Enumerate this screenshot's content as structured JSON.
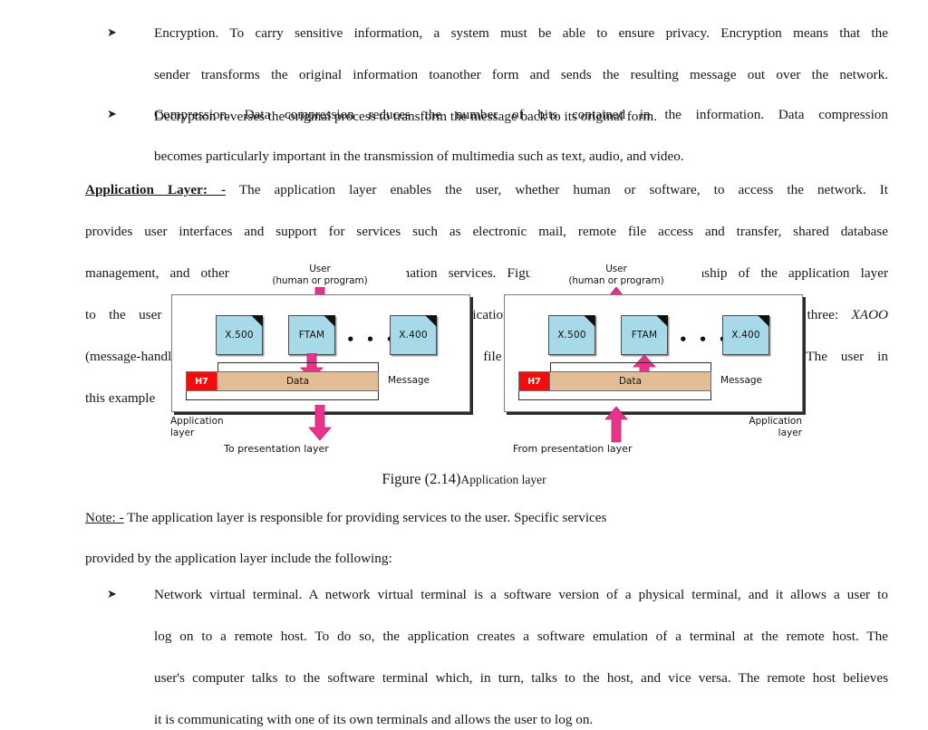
{
  "document": {
    "page_kind": "lecture-notes-page",
    "figure_number": "2.14"
  },
  "bullets_top": [
    {
      "marker": "➤",
      "lines": [
        "Encryption. To carry sensitive information, a system must be able to ensure privacy. Encryption means that the",
        "sender transforms the original information toanother form and sends the resulting message out over the network.",
        "Decryption reverses the original process to transform the message back to its original form."
      ]
    },
    {
      "marker": "➤",
      "lines": [
        "Compression. Data compression reduces the number of bits contained in the information. Data compression",
        "becomes particularly important in the transmission of multimedia such as text, audio, and video."
      ]
    }
  ],
  "application_layer_para": {
    "lead": "Application Layer: -",
    "line1_rest": "The application layer enables the user, whether human or software, to access the network. It",
    "line2": "provides user interfaces and support for services such as electronic mail, remote file access and transfer, shared database",
    "line3": "management, and other types of distributed information services. Figure 2.14 shows the relationship of the application layer",
    "line4_a": "to the user and the presentationlayer. Of the many application services available, the figure shows only three:",
    "line4_italic": "XAOO",
    "line5": "(message-handling services), X.500 (directory services), and file transfer, access, and management (FTAM). The user in",
    "line6": "this example"
  },
  "figure": {
    "caption_big": "Figure (2.14)",
    "caption_small": "Application layer",
    "left_panel": {
      "user_line1": "User",
      "user_line2": "(human or program)",
      "docs": [
        "X.500",
        "FTAM",
        "X.400"
      ],
      "dots": "• • •",
      "header_label": "H7",
      "data_label": "Data",
      "message_label": "Message",
      "layer_line1": "Application",
      "layer_line2": "layer",
      "flow_label": "To presentation layer",
      "flow_direction": "down"
    },
    "right_panel": {
      "user_line1": "User",
      "user_line2": "(human or program)",
      "docs": [
        "X.500",
        "FTAM",
        "X.400"
      ],
      "dots": "• • •",
      "header_label": "H7",
      "data_label": "Data",
      "message_label": "Message",
      "layer_line1": "Application",
      "layer_line2": "layer",
      "flow_label": "From presentation layer",
      "flow_direction": "up"
    },
    "colors": {
      "arrow": "#e8338a",
      "doc_fill": "#a8d9e8",
      "header_fill": "#f40d0d",
      "data_fill": "#e3bd95",
      "panel_border": "#7c7c7c",
      "panel_shadow": "#2b2b2b"
    }
  },
  "note": {
    "lead": "Note: -",
    "line1_rest": "The application layer is responsible for providing services to the user. Specific services",
    "line2": "provided by the application layer include the following:"
  },
  "bullets_bottom": [
    {
      "marker": "➤",
      "lines": [
        "Network virtual terminal. A network virtual terminal is a software version of a physical terminal, and it allows a user to",
        "log on to a remote host. To do so, the application creates a software emulation of a terminal at the remote host. The",
        "user's computer talks to the software terminal which, in turn, talks to the host, and vice versa. The remote host believes",
        "it is communicating with one of its own terminals and allows the user to log on."
      ]
    }
  ]
}
